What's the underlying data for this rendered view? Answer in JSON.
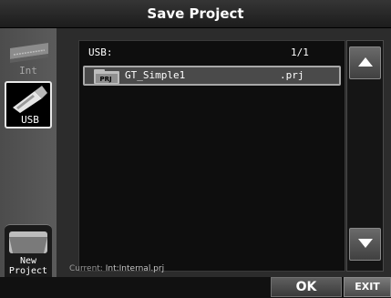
{
  "title": "Save Project",
  "sidebar": {
    "int_label": "Int",
    "usb_label": "USB",
    "new_project_line1": "New",
    "new_project_line2": "Project"
  },
  "browser": {
    "path": "USB:",
    "page": "1/1",
    "files": [
      {
        "name": "GT_Simple1",
        "ext": ".prj",
        "icon": "PRJ",
        "selected": true
      }
    ]
  },
  "current": {
    "label": "Current:",
    "value": "Int:Internal.prj"
  },
  "buttons": {
    "ok": "OK",
    "exit": "EXIT"
  },
  "colors": {
    "selected_row": "#4a4a4a",
    "selected_border": "#a8a8a8"
  }
}
